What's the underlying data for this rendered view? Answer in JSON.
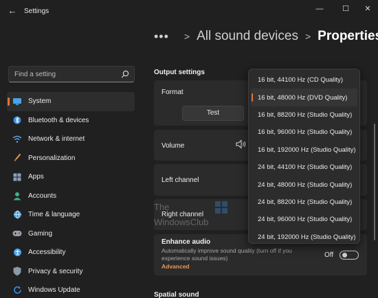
{
  "window": {
    "title": "Settings",
    "back_glyph": "←",
    "minimize_glyph": "—",
    "maximize_glyph": "☐",
    "close_glyph": "✕"
  },
  "breadcrumb": {
    "dots": "•••",
    "sep1": ">",
    "sep2": ">",
    "parent": "All sound devices",
    "current": "Properties"
  },
  "search": {
    "placeholder": "Find a setting",
    "icon": "search-icon"
  },
  "sidebar": {
    "items": [
      {
        "label": "System",
        "icon": "system-icon",
        "color": "#4aa3e8",
        "active": true
      },
      {
        "label": "Bluetooth & devices",
        "icon": "bluetooth-icon",
        "color": "#3b8ee0"
      },
      {
        "label": "Network & internet",
        "icon": "wifi-icon",
        "color": "#5aa6e6"
      },
      {
        "label": "Personalization",
        "icon": "brush-icon",
        "color": "#e0a050"
      },
      {
        "label": "Apps",
        "icon": "apps-icon",
        "color": "#8aa0b8"
      },
      {
        "label": "Accounts",
        "icon": "accounts-icon",
        "color": "#3fb08a"
      },
      {
        "label": "Time & language",
        "icon": "globe-icon",
        "color": "#3b9ee0"
      },
      {
        "label": "Gaming",
        "icon": "gaming-icon",
        "color": "#9aa0a8"
      },
      {
        "label": "Accessibility",
        "icon": "accessibility-icon",
        "color": "#4aa3e8"
      },
      {
        "label": "Privacy & security",
        "icon": "shield-icon",
        "color": "#8a98a8"
      },
      {
        "label": "Windows Update",
        "icon": "update-icon",
        "color": "#3b8ee0"
      }
    ]
  },
  "main": {
    "section_label": "Output settings",
    "format_label": "Format",
    "test_button": "Test",
    "volume_label": "Volume",
    "left_channel_label": "Left channel",
    "right_channel_label": "Right channel",
    "enhance": {
      "title": "Enhance audio",
      "description": "Automatically improve sound quality (turn off if you experience sound issues)",
      "advanced": "Advanced",
      "toggle_text": "Off",
      "toggle_on": false
    },
    "spatial_label": "Spatial sound"
  },
  "dropdown": {
    "selected_index": 1,
    "options": [
      "16 bit, 44100 Hz (CD Quality)",
      "16 bit, 48000 Hz (DVD Quality)",
      "16 bit, 88200 Hz (Studio Quality)",
      "16 bit, 96000 Hz (Studio Quality)",
      "16 bit, 192000 Hz (Studio Quality)",
      "24 bit, 44100 Hz (Studio Quality)",
      "24 bit, 48000 Hz (Studio Quality)",
      "24 bit, 88200 Hz (Studio Quality)",
      "24 bit, 96000 Hz (Studio Quality)",
      "24 bit, 192000 Hz (Studio Quality)"
    ]
  },
  "watermark": {
    "line1": "The",
    "line2": "WindowsClub"
  },
  "colors": {
    "accent": "#e0763a",
    "background": "#202020",
    "card": "#2b2b2b"
  }
}
